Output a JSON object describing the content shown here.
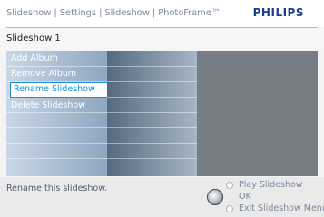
{
  "header": {
    "breadcrumb": "Slideshow | Settings | Slideshow | PhotoFrame™",
    "brand": "PHILIPS"
  },
  "subheader": {
    "title": "Slideshow 1"
  },
  "menu": {
    "items": [
      {
        "label": "Add Album"
      },
      {
        "label": "Remove Album"
      },
      {
        "label": "Rename Slideshow",
        "selected": true
      },
      {
        "label": "Delete Slideshow"
      }
    ]
  },
  "footer": {
    "status": "Rename this slideshow.",
    "legend": [
      {
        "label": "Play Slideshow"
      },
      {
        "label": "OK"
      },
      {
        "label": "Exit Slideshow Menu"
      }
    ]
  },
  "icons": {
    "ok_knob": "ok-knob-icon",
    "legend_dot": "circle-icon"
  },
  "colors": {
    "brand": "#1c3f94",
    "selection_border": "#1a8fd6"
  }
}
